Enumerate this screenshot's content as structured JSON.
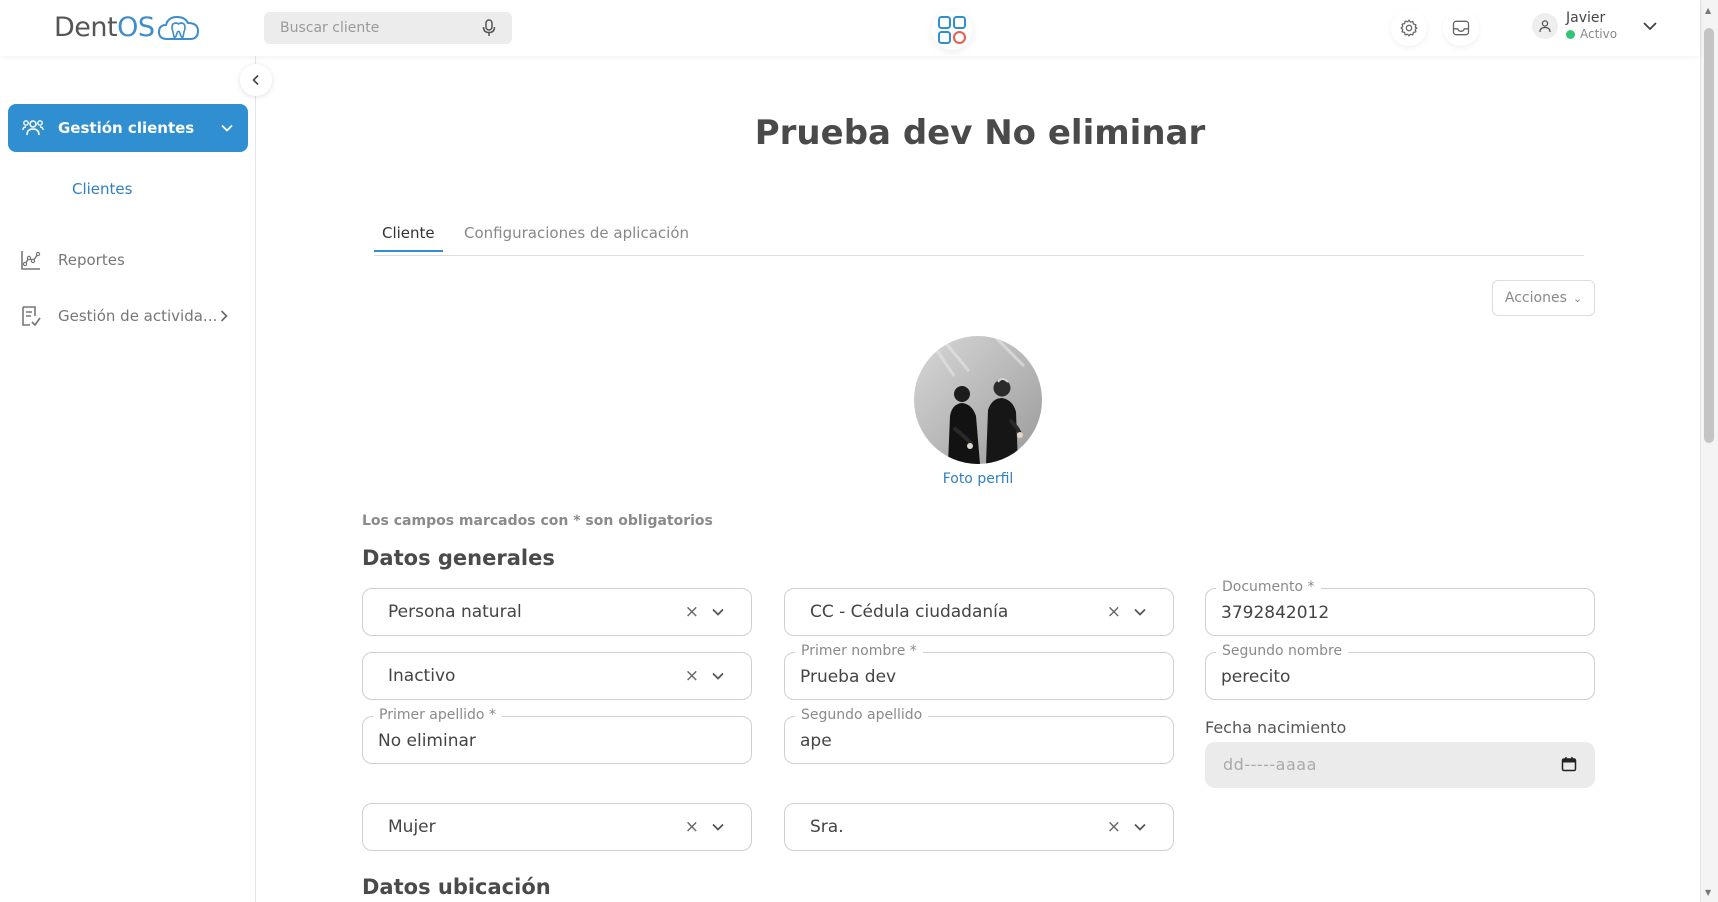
{
  "app": {
    "logo_text_a": "Dent",
    "logo_text_b": "OS",
    "accent": "#2f8fd0"
  },
  "header": {
    "search_placeholder": "Buscar cliente",
    "user_name": "Javier",
    "user_status": "Activo"
  },
  "sidebar": {
    "active_item": "Gestión clientes",
    "sub_item": "Clientes",
    "items": [
      {
        "label": "Reportes",
        "icon": "chart-icon"
      },
      {
        "label": "Gestión de activida...",
        "icon": "checklist-icon"
      }
    ]
  },
  "main": {
    "title": "Prueba dev No eliminar",
    "tabs": [
      {
        "label": "Cliente",
        "active": true
      },
      {
        "label": "Configuraciones de aplicación",
        "active": false
      }
    ],
    "actions_label": "Acciones",
    "photo_label": "Foto perfil",
    "required_note": "Los campos marcados con * son obligatorios",
    "section_general": "Datos generales",
    "section_location": "Datos ubicación"
  },
  "form": {
    "tipo_persona": "Persona natural",
    "tipo_documento": "CC - Cédula ciudadanía",
    "documento_label": "Documento *",
    "documento_value": "3792842012",
    "estado": "Inactivo",
    "primer_nombre_label": "Primer nombre *",
    "primer_nombre_value": "Prueba dev",
    "segundo_nombre_label": "Segundo nombre",
    "segundo_nombre_value": "perecito",
    "primer_apellido_label": "Primer apellido *",
    "primer_apellido_value": "No eliminar",
    "segundo_apellido_label": "Segundo apellido",
    "segundo_apellido_value": "ape",
    "fecha_label": "Fecha nacimiento",
    "fecha_placeholder": "dd-----aaaa",
    "genero": "Mujer",
    "tratamiento": "Sra.",
    "clear_symbol": "×"
  }
}
